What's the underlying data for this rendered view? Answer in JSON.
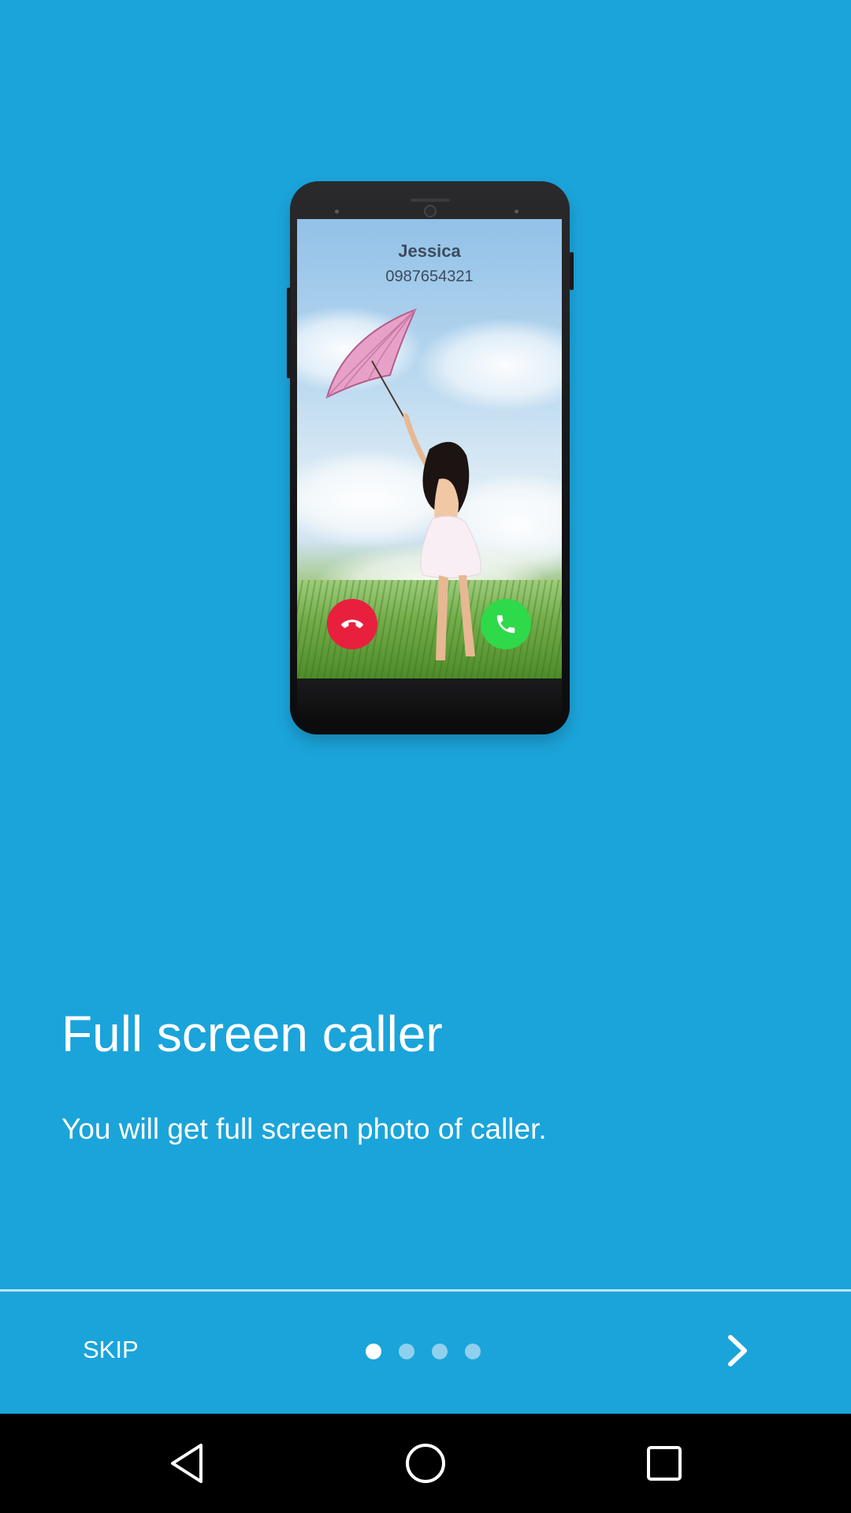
{
  "onboarding": {
    "title": "Full screen caller",
    "subtitle": "You will get full screen photo of caller.",
    "illustration": {
      "caller_name": "Jessica",
      "caller_number": "0987654321",
      "decline_icon": "phone-hangup-icon",
      "accept_icon": "phone-accept-icon"
    }
  },
  "footer": {
    "skip_label": "SKIP",
    "page_indicator": {
      "current": 1,
      "total": 4
    },
    "next_icon": "chevron-right-icon"
  },
  "system_nav": {
    "back_icon": "back-triangle-icon",
    "home_icon": "home-circle-icon",
    "recents_icon": "recents-square-icon"
  },
  "colors": {
    "background": "#1BA4DA",
    "text": "#FFFFFF",
    "dot_active": "#FFFFFF",
    "dot_inactive": "#8FD0EE",
    "decline": "#E8203D",
    "accept": "#2ED94A",
    "nav_bar": "#000000"
  }
}
